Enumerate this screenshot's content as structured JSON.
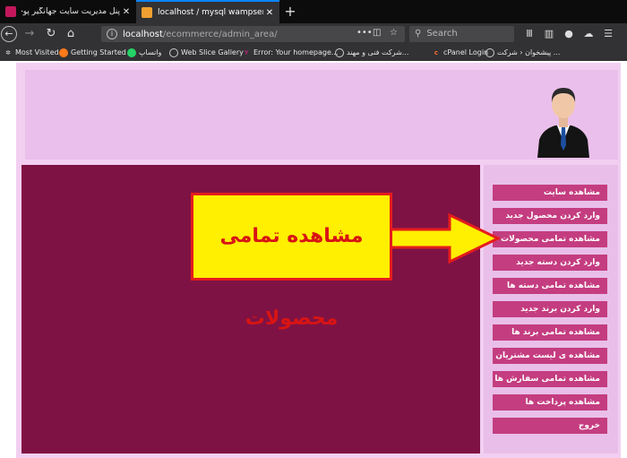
{
  "browser": {
    "tabs": [
      {
        "title": "پنل مدیریت سایت جهانگیر پوچتم",
        "active": false
      },
      {
        "title": "localhost / mysql wampserver | ph",
        "active": true
      }
    ],
    "new_tab_label": "+",
    "address_bar": {
      "host": "localhost",
      "path": "/ecommerce/admin_area/"
    },
    "search_placeholder": "Search",
    "bookmarks": [
      {
        "label": "Most Visited",
        "icon": "gear-icon"
      },
      {
        "label": "Getting Started",
        "icon": "firefox-icon"
      },
      {
        "label": "واتساپ",
        "icon": "whatsapp-icon"
      },
      {
        "label": "Web Slice Gallery",
        "icon": "globe-icon"
      },
      {
        "label": "Error: Your homepage...",
        "icon": "yoast-icon"
      },
      {
        "label": "شرکت فنی و مهند...",
        "icon": "globe-icon"
      },
      {
        "label": "cPanel Login",
        "icon": "cpanel-icon"
      },
      {
        "label": "پیشخوان ‹ شرکت ...",
        "icon": "globe-icon"
      }
    ]
  },
  "sidebar": {
    "items": [
      {
        "label": "مشاهده سایت"
      },
      {
        "label": "وارد کردن محصول جدید"
      },
      {
        "label": "مشاهده تمامی محصولات"
      },
      {
        "label": "وارد کردن دسته جدید"
      },
      {
        "label": "مشاهده تمامی دسته ها"
      },
      {
        "label": "وارد کردن برند جدید"
      },
      {
        "label": "مشاهده تمامی برند ها"
      },
      {
        "label": "مشاهده ی لیست مشتریان"
      },
      {
        "label": "مشاهده تمامی سفارش ها"
      },
      {
        "label": "مشاهده پرداخت ها"
      },
      {
        "label": "خروج"
      }
    ]
  },
  "annotation": {
    "text": "مشاهده تمامی محصولات"
  },
  "colors": {
    "main_panel": "#7f1244",
    "menu_button": "#c43d80",
    "header": "#ebbfeb",
    "callout_fill": "#ffef00",
    "callout_border": "#e51c1c"
  }
}
